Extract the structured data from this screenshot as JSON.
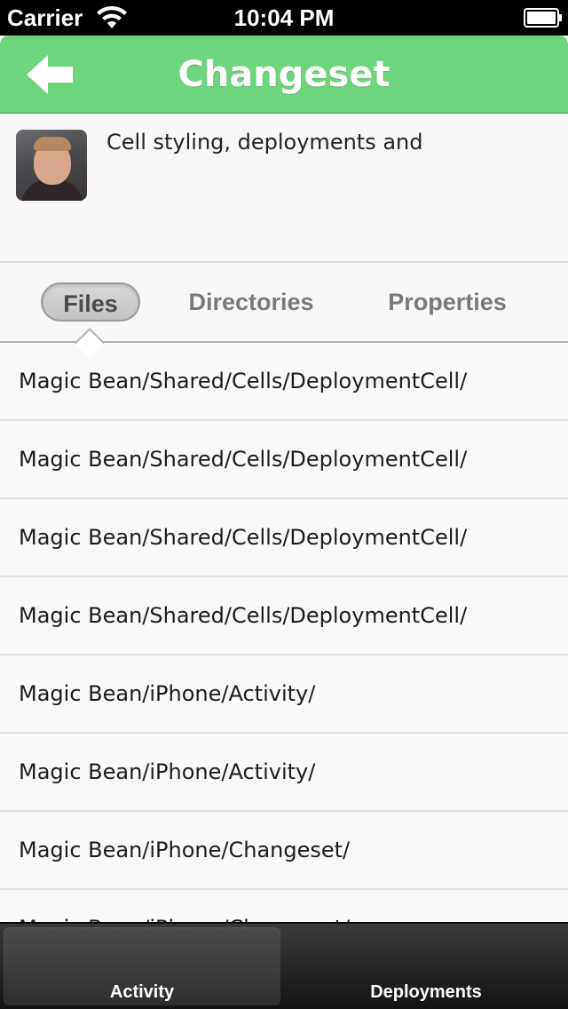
{
  "status_bar": {
    "carrier": "Carrier",
    "time": "10:04 PM",
    "wifi_icon": "wifi-icon",
    "battery_icon": "battery-icon"
  },
  "nav": {
    "title": "Changeset",
    "back_icon": "arrow-left-icon",
    "color": "#6dd57c"
  },
  "changeset": {
    "avatar_icon": "avatar",
    "message": "Cell styling, deployments and"
  },
  "tabs": {
    "items": [
      {
        "label": "Files",
        "selected": true
      },
      {
        "label": "Directories",
        "selected": false
      },
      {
        "label": "Properties",
        "selected": false
      }
    ]
  },
  "files": [
    "Magic Bean/Shared/Cells/DeploymentCell/",
    "Magic Bean/Shared/Cells/DeploymentCell/",
    "Magic Bean/Shared/Cells/DeploymentCell/",
    "Magic Bean/Shared/Cells/DeploymentCell/",
    "Magic Bean/iPhone/Activity/",
    "Magic Bean/iPhone/Activity/",
    "Magic Bean/iPhone/Changeset/",
    "Magic Bean/iPhone/Changeset/"
  ],
  "tab_bar": {
    "items": [
      {
        "label": "Activity",
        "selected": true
      },
      {
        "label": "Deployments",
        "selected": false
      }
    ]
  }
}
